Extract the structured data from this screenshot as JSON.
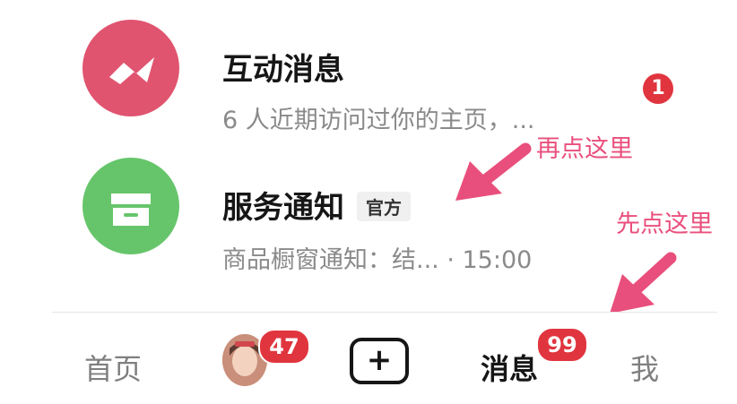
{
  "messages": [
    {
      "title": "互动消息",
      "subtitle": "6 人近期访问过你的主页，...",
      "icon": "zigzag-wave-icon",
      "icon_color": "#e0546f",
      "unread": "1"
    },
    {
      "title": "服务通知",
      "tag": "官方",
      "subtitle": "商品橱窗通知：结... · 15:00",
      "icon": "archive-box-icon",
      "icon_color": "#66c56a"
    }
  ],
  "annotations": {
    "second_click": "再点这里",
    "first_click": "先点这里",
    "color": "#e94f7c"
  },
  "tabbar": {
    "home": "首页",
    "friends_badge": "47",
    "plus": "+",
    "messages": "消息",
    "messages_badge": "99",
    "me": "我"
  },
  "colors": {
    "badge": "#e0353f"
  }
}
